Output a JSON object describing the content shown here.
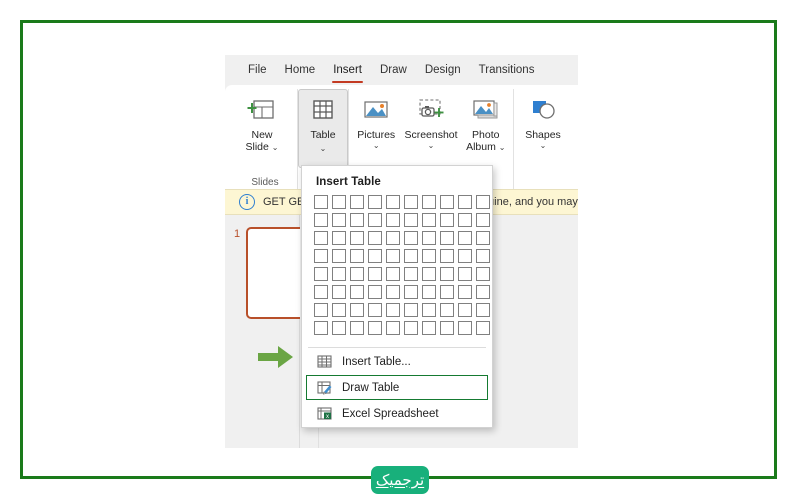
{
  "frame": {
    "color": "#1a7a1a"
  },
  "app": {
    "ribbon_tabs": [
      {
        "label": "File",
        "active": false
      },
      {
        "label": "Home",
        "active": false
      },
      {
        "label": "Insert",
        "active": true
      },
      {
        "label": "Draw",
        "active": false
      },
      {
        "label": "Design",
        "active": false
      },
      {
        "label": "Transitions",
        "active": false
      }
    ],
    "ribbon_groups": [
      {
        "group_label": "Slides",
        "buttons": [
          {
            "line1": "New",
            "line2": "Slide",
            "chevron": "⌄",
            "icon": "new-slide-icon",
            "selected": false
          }
        ]
      },
      {
        "group_label": "",
        "buttons": [
          {
            "line1": "Table",
            "line2": "",
            "chevron": "⌄",
            "icon": "table-icon",
            "selected": true
          }
        ]
      },
      {
        "group_label": "",
        "buttons": [
          {
            "line1": "Pictures",
            "line2": "",
            "chevron": "⌄",
            "icon": "pictures-icon",
            "selected": false
          },
          {
            "line1": "Screenshot",
            "line2": "",
            "chevron": "⌄",
            "icon": "screenshot-icon",
            "selected": false
          },
          {
            "line1": "Photo",
            "line2": "Album",
            "chevron": "⌄",
            "icon": "photo-album-icon",
            "selected": false
          }
        ]
      },
      {
        "group_label": "",
        "buttons": [
          {
            "line1": "Shapes",
            "line2": "",
            "chevron": "⌄",
            "icon": "shapes-icon",
            "selected": false
          }
        ]
      }
    ],
    "info_bar": {
      "icon": "info-icon",
      "icon_glyph": "i",
      "text": "GET GENUINE OFFICE   Your license isn't genuine, and you may be a victim",
      "accent": "#2f7fd0",
      "background": "#fdf6d3"
    },
    "slide_pane": {
      "slide_number": "1",
      "thumb_border_color": "#b8502a",
      "arrow_icon": "green-arrow-icon",
      "arrow_color": "#6aa544"
    }
  },
  "dropdown": {
    "title": "Insert Table",
    "grid": {
      "columns": 10,
      "rows": 8,
      "cell_border": "#808080"
    },
    "items": [
      {
        "label": "Insert Table...",
        "underline_char": "I",
        "icon": "insert-table-icon",
        "highlighted": false
      },
      {
        "label": "Draw Table",
        "underline_char": "D",
        "icon": "draw-table-icon",
        "highlighted": true
      },
      {
        "label": "Excel Spreadsheet",
        "underline_char": "x",
        "icon": "excel-spreadsheet-icon",
        "highlighted": false
      }
    ],
    "highlight_color": "#157a31"
  },
  "watermark": {
    "text": "ترجمیک",
    "background": "#18b07b",
    "text_color": "#ffffff"
  }
}
